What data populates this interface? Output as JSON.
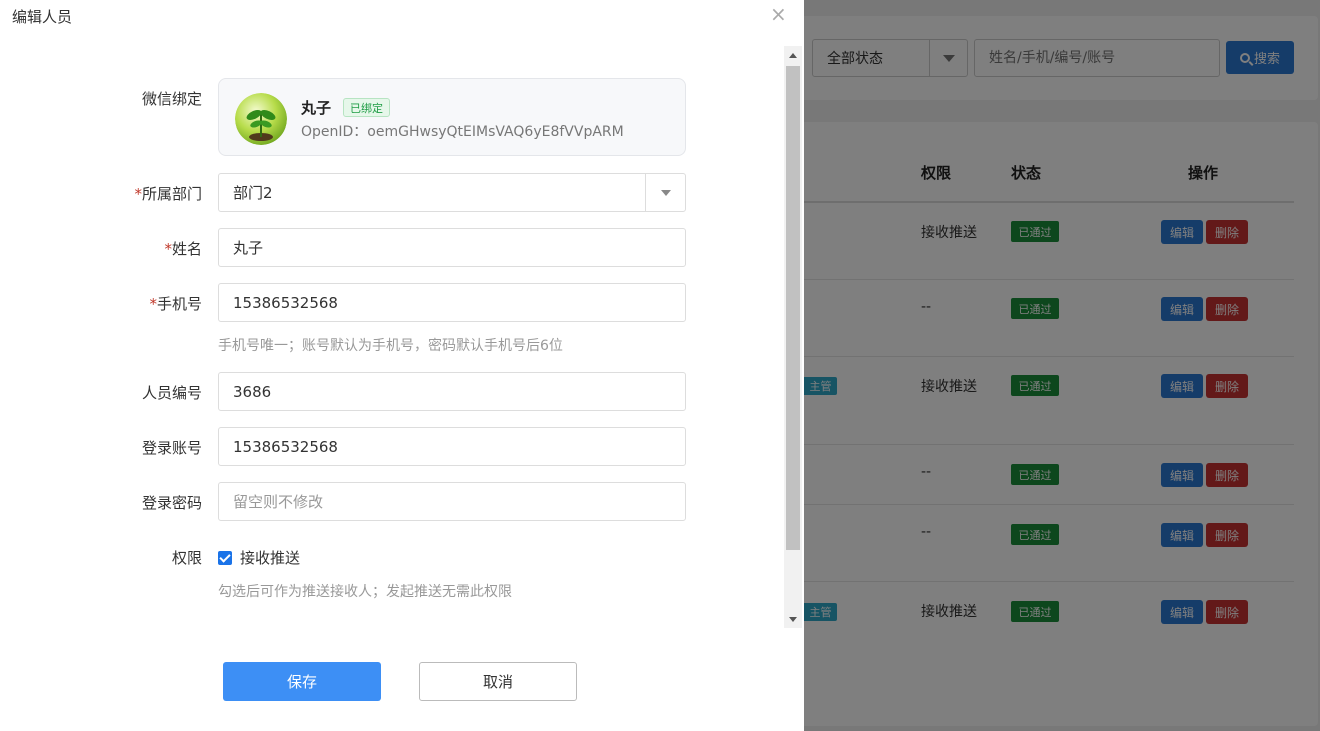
{
  "drawer": {
    "title": "编辑人员",
    "close_icon": "×",
    "wechat": {
      "label": "微信绑定",
      "name": "丸子",
      "status_tag": "已绑定",
      "openid_text": "OpenID：oemGHwsyQtEIMsVAQ6yE8fVVpARM"
    },
    "department": {
      "required_mark": "*",
      "label": "所属部门",
      "value": "部门2"
    },
    "name": {
      "required_mark": "*",
      "label": "姓名",
      "value": "丸子"
    },
    "phone": {
      "required_mark": "*",
      "label": "手机号",
      "value": "15386532568",
      "hint": "手机号唯一；账号默认为手机号，密码默认手机号后6位"
    },
    "staff_no": {
      "label": "人员编号",
      "value": "3686"
    },
    "account": {
      "label": "登录账号",
      "value": "15386532568"
    },
    "password": {
      "label": "登录密码",
      "placeholder": "留空则不修改"
    },
    "permission": {
      "label": "权限",
      "option": "接收推送",
      "checked": true,
      "hint": "勾选后可作为推送接收人；发起推送无需此权限"
    },
    "save_label": "保存",
    "cancel_label": "取消"
  },
  "background": {
    "status_filter": "全部状态",
    "search_placeholder": "姓名/手机/编号/账号",
    "search_label": "搜索",
    "table": {
      "headers": {
        "perm": "权限",
        "status": "状态",
        "action": "操作"
      },
      "rows": [
        {
          "perm": "接收推送",
          "status": "已通过",
          "edit": "编辑",
          "delete": "删除",
          "role": ""
        },
        {
          "perm": "--",
          "status": "已通过",
          "edit": "编辑",
          "delete": "删除",
          "role": ""
        },
        {
          "perm": "接收推送",
          "status": "已通过",
          "edit": "编辑",
          "delete": "删除",
          "role": "主管"
        },
        {
          "perm": "--",
          "status": "已通过",
          "edit": "编辑",
          "delete": "删除",
          "role": ""
        },
        {
          "perm": "--",
          "status": "已通过",
          "edit": "编辑",
          "delete": "删除",
          "role": ""
        },
        {
          "perm": "接收推送",
          "status": "已通过",
          "edit": "编辑",
          "delete": "删除",
          "role": "主管"
        }
      ]
    }
  },
  "colors": {
    "primary": "#3d8ff5",
    "success": "#1a8f3a",
    "danger": "#c73232",
    "required": "#c0392b"
  }
}
